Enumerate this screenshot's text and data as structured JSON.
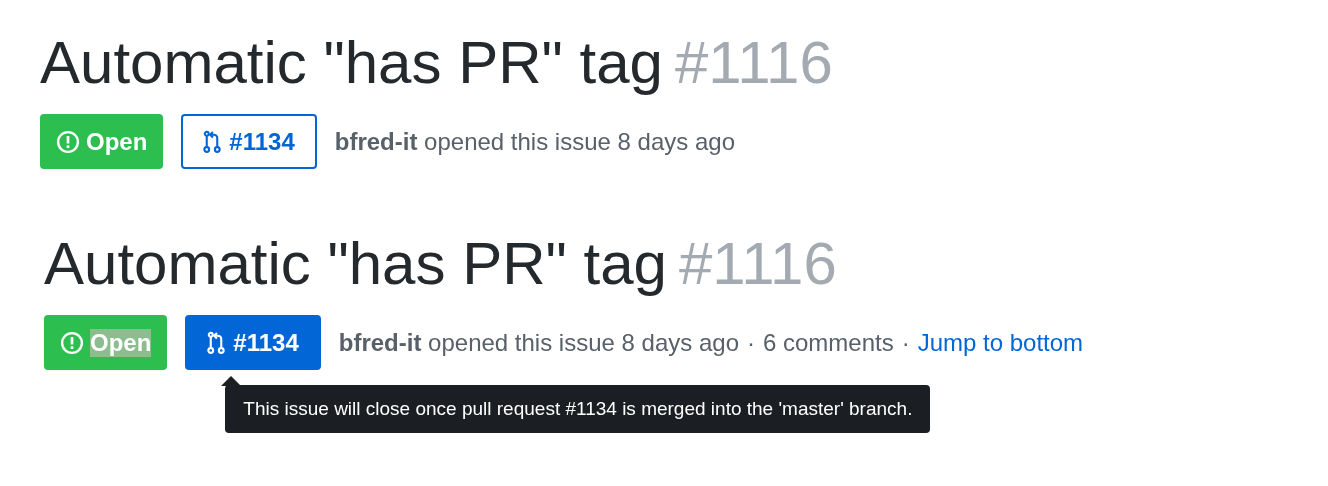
{
  "issues": [
    {
      "title": "Automatic \"has PR\" tag",
      "number": "#1116",
      "status": {
        "label": "Open",
        "highlighted": false
      },
      "pr_link": {
        "label": "#1134",
        "hovered": false
      },
      "author": "bfred-it",
      "action": "opened this issue 8 days ago"
    },
    {
      "title": "Automatic \"has PR\" tag",
      "number": "#1116",
      "status": {
        "label": "Open",
        "highlighted": true
      },
      "pr_link": {
        "label": "#1134",
        "hovered": true
      },
      "author": "bfred-it",
      "action": "opened this issue 8 days ago",
      "meta": [
        {
          "kind": "separator",
          "text": "·"
        },
        {
          "kind": "text",
          "text": "6 comments"
        },
        {
          "kind": "separator",
          "text": "·"
        },
        {
          "kind": "link",
          "text": "Jump to bottom"
        }
      ],
      "tooltip": "This issue will close once pull request #1134 is merged into the 'master' branch."
    }
  ]
}
